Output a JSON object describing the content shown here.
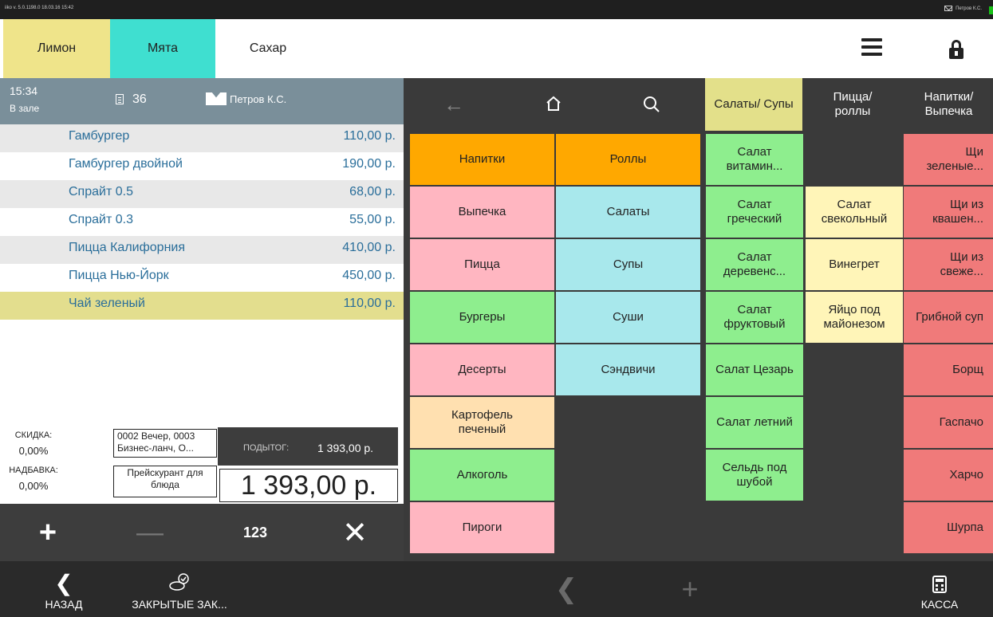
{
  "status_bar": {
    "version": "iiko v. 5.0.1198.0   18.03.16  15:42",
    "user": "Петров К.С."
  },
  "tabs": [
    {
      "label": "Лимон"
    },
    {
      "label": "Мята"
    },
    {
      "label": "Сахар"
    }
  ],
  "order": {
    "time": "15:34",
    "location": "В зале",
    "number": "36",
    "waiter": "Петров К.С.",
    "items": [
      {
        "name": "Гамбургер",
        "price": "110,00 р."
      },
      {
        "name": "Гамбургер двойной",
        "price": "190,00 р."
      },
      {
        "name": "Спрайт 0.5",
        "price": "68,00 р."
      },
      {
        "name": "Спрайт 0.3",
        "price": "55,00 р."
      },
      {
        "name": "Пицца Калифорния",
        "price": "410,00 р."
      },
      {
        "name": "Пицца Нью-Йорк",
        "price": "450,00 р."
      },
      {
        "name": "Чай зеленый",
        "price": "110,00 р."
      }
    ],
    "discount_label": "СКИДКА:",
    "discount_value": "0,00%",
    "markup_label": "НАДБАВКА:",
    "markup_value": "0,00%",
    "discount_program": "0002 Вечер, 0003 Бизнес-ланч, О...",
    "price_list": "Прейскурант для блюда",
    "subtotal_label": "ПОДЫТОГ:",
    "subtotal_value": "1 393,00 р.",
    "total": "1 393,00 р."
  },
  "actions": {
    "plus": "+",
    "minus": "—",
    "numpad": "123",
    "close": "✕"
  },
  "categories": [
    [
      "Напитки",
      "Роллы"
    ],
    [
      "Выпечка",
      "Салаты"
    ],
    [
      "Пицца",
      "Супы"
    ],
    [
      "Бургеры",
      "Суши"
    ],
    [
      "Десерты",
      "Сэндвичи"
    ],
    [
      "Картофель печеный",
      ""
    ],
    [
      "Алкоголь",
      ""
    ],
    [
      "Пироги",
      ""
    ]
  ],
  "groups": [
    "Салаты/ Супы",
    "Пицца/ роллы",
    "Напитки/ Выпечка"
  ],
  "salads": [
    "Салат витамин...",
    "Салат греческий",
    "Салат деревенс...",
    "Салат фруктовый",
    "Салат Цезарь",
    "Салат летний",
    "Сельдь под шубой"
  ],
  "middle": [
    "Салат свекольный",
    "Винегрет",
    "Яйцо под майонезом"
  ],
  "soups": [
    "Щи зеленые...",
    "Щи из квашен...",
    "Щи из свеже...",
    "Грибной суп",
    "Борщ",
    "Гаспачо",
    "Харчо",
    "Шурпа"
  ],
  "bottom": {
    "back": "НАЗАД",
    "closed": "ЗАКРЫТЫЕ ЗАК...",
    "kassa": "КАССА"
  },
  "colors": {
    "tab_lemon": "#efe48a",
    "tab_mint": "#3fdfd0",
    "orange": "#ffa800",
    "pink": "#ffb6c1",
    "cyan": "#a8e8ec",
    "green": "#8eee8e",
    "beige": "#ffe0b0",
    "yellow": "#fff5b8",
    "red": "#f07a7a",
    "group_active": "#e3e08a"
  }
}
